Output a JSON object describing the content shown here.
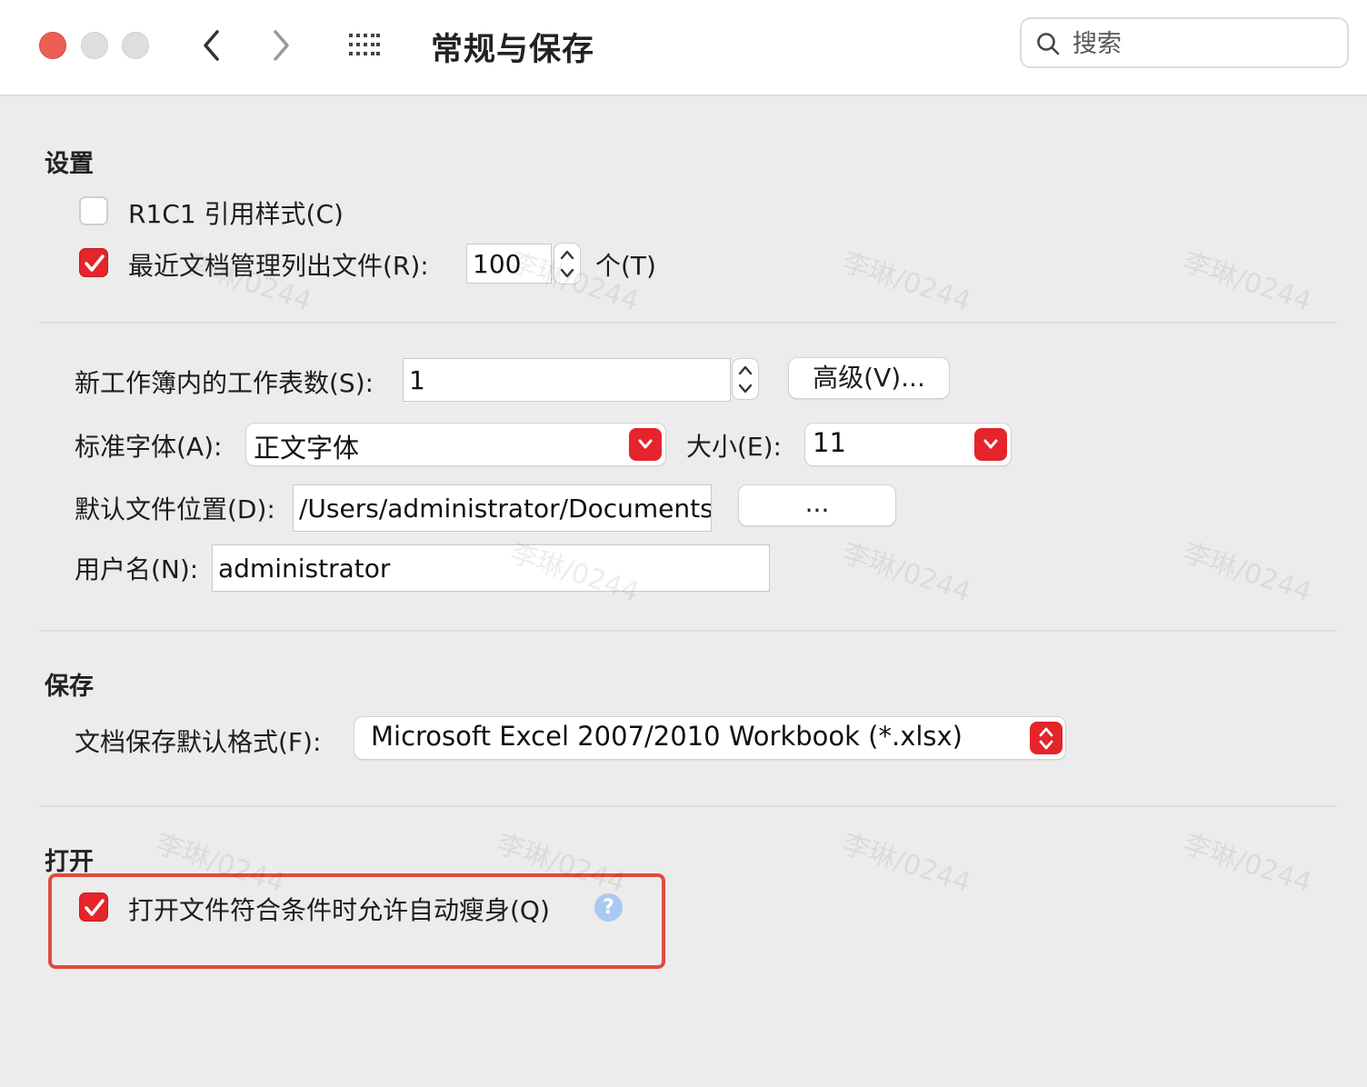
{
  "window": {
    "title": "常规与保存",
    "search_placeholder": "搜索"
  },
  "settings": {
    "section_title": "设置",
    "r1c1_label": "R1C1 引用样式(C)",
    "r1c1_checked": false,
    "recent_docs_label": "最近文档管理列出文件(R):",
    "recent_docs_checked": true,
    "recent_docs_value": "100",
    "recent_docs_unit": "个(T)"
  },
  "workbook": {
    "sheets_label": "新工作簿内的工作表数(S):",
    "sheets_value": "1",
    "advanced_button": "高级(V)...",
    "font_label": "标准字体(A):",
    "font_value": "正文字体",
    "size_label": "大小(E):",
    "size_value": "11",
    "location_label": "默认文件位置(D):",
    "location_value": "/Users/administrator/Documents",
    "browse_button": "...",
    "username_label": "用户名(N):",
    "username_value": "administrator"
  },
  "save": {
    "section_title": "保存",
    "format_label": "文档保存默认格式(F):",
    "format_value": "Microsoft Excel 2007/2010 Workbook (*.xlsx)"
  },
  "open": {
    "section_title": "打开",
    "auto_slim_label": "打开文件符合条件时允许自动瘦身(Q)",
    "auto_slim_checked": true,
    "help_glyph": "?"
  },
  "watermark_text": "李琳/0244",
  "colors": {
    "accent": "#e5242b",
    "highlight_border": "#e04b3f",
    "help_icon": "#a9c9f0",
    "close_light": "#ec5f57"
  }
}
